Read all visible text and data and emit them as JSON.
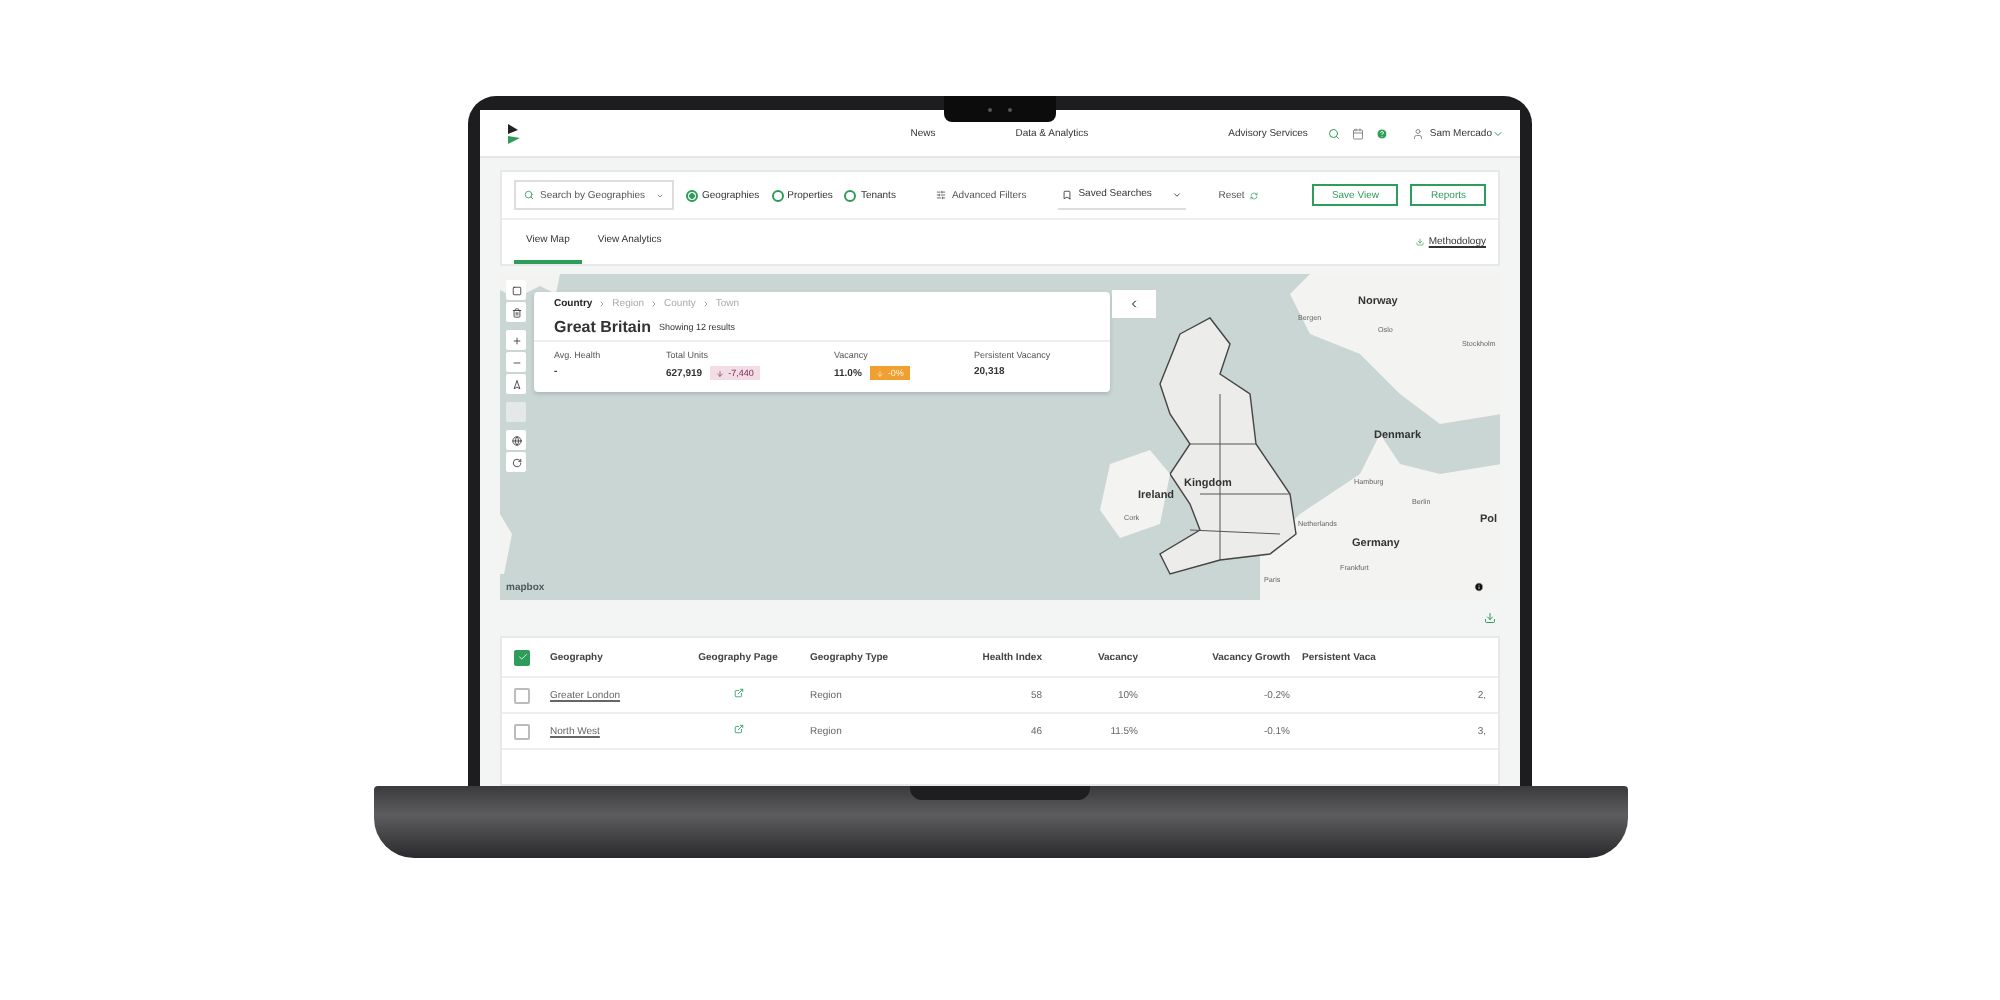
{
  "nav": {
    "links": [
      "News",
      "Data & Analytics"
    ],
    "advisory": "Advisory Services",
    "user": "Sam Mercado"
  },
  "filters": {
    "search": {
      "placeholder": "Search by Geographies"
    },
    "modes": [
      {
        "label": "Geographies",
        "selected": true
      },
      {
        "label": "Properties",
        "selected": false
      },
      {
        "label": "Tenants",
        "selected": false
      }
    ],
    "advanced": "Advanced Filters",
    "saved": "Saved Searches",
    "reset": "Reset",
    "buttons": [
      "Save View",
      "Reports"
    ]
  },
  "tabs": [
    {
      "label": "View Map",
      "selected": true
    },
    {
      "label": "View Analytics",
      "selected": false
    }
  ],
  "methodology": "Methodology",
  "map": {
    "breadcrumb": [
      {
        "label": "Country",
        "selected": true
      },
      {
        "label": "Region",
        "selected": false
      },
      {
        "label": "County",
        "selected": false
      },
      {
        "label": "Town",
        "selected": false
      }
    ],
    "title": "Great Britain",
    "subtitle": "Showing 12 results",
    "metrics": [
      {
        "label": "Avg. Health",
        "value": "-"
      },
      {
        "label": "Total Units",
        "value": "627,919",
        "change": {
          "text": "-7,440",
          "kind": "mild",
          "color": "#f2dde4"
        }
      },
      {
        "label": "Vacancy",
        "value": "11.0%",
        "change": {
          "text": "-0%",
          "kind": "strong",
          "color": "#f0a030"
        }
      },
      {
        "label": "Persistent Vacancy",
        "value": "20,318"
      }
    ],
    "labels": [
      {
        "text": "Norway",
        "kind": "country"
      },
      {
        "text": "Bergen",
        "kind": "city"
      },
      {
        "text": "Oslo",
        "kind": "city"
      },
      {
        "text": "Stockholm",
        "kind": "city"
      },
      {
        "text": "Denmark",
        "kind": "country"
      },
      {
        "text": "Hamburg",
        "kind": "city"
      },
      {
        "text": "Berlin",
        "kind": "city"
      },
      {
        "text": "Netherlands",
        "kind": "city"
      },
      {
        "text": "Germany",
        "kind": "country"
      },
      {
        "text": "Frankfurt",
        "kind": "city"
      },
      {
        "text": "Paris",
        "kind": "city"
      },
      {
        "text": "Ireland",
        "kind": "country"
      },
      {
        "text": "Cork",
        "kind": "city"
      },
      {
        "text": "Kingdom",
        "kind": "country"
      },
      {
        "text": "Pol",
        "kind": "country"
      }
    ],
    "attribution": "mapbox"
  },
  "table": {
    "header_checked": true,
    "columns": [
      "Geography",
      "Geography Page",
      "Geography Type",
      "Health Index",
      "Vacancy",
      "Vacancy Growth",
      "Persistent Vaca"
    ],
    "rows": [
      {
        "checked": false,
        "geography": "Greater London",
        "type": "Region",
        "health": "58",
        "vacancy": "10%",
        "growth": "-0.2%",
        "persistent": "2,"
      },
      {
        "checked": false,
        "geography": "North West",
        "type": "Region",
        "health": "46",
        "vacancy": "11.5%",
        "growth": "-0.1%",
        "persistent": "3,"
      }
    ]
  }
}
